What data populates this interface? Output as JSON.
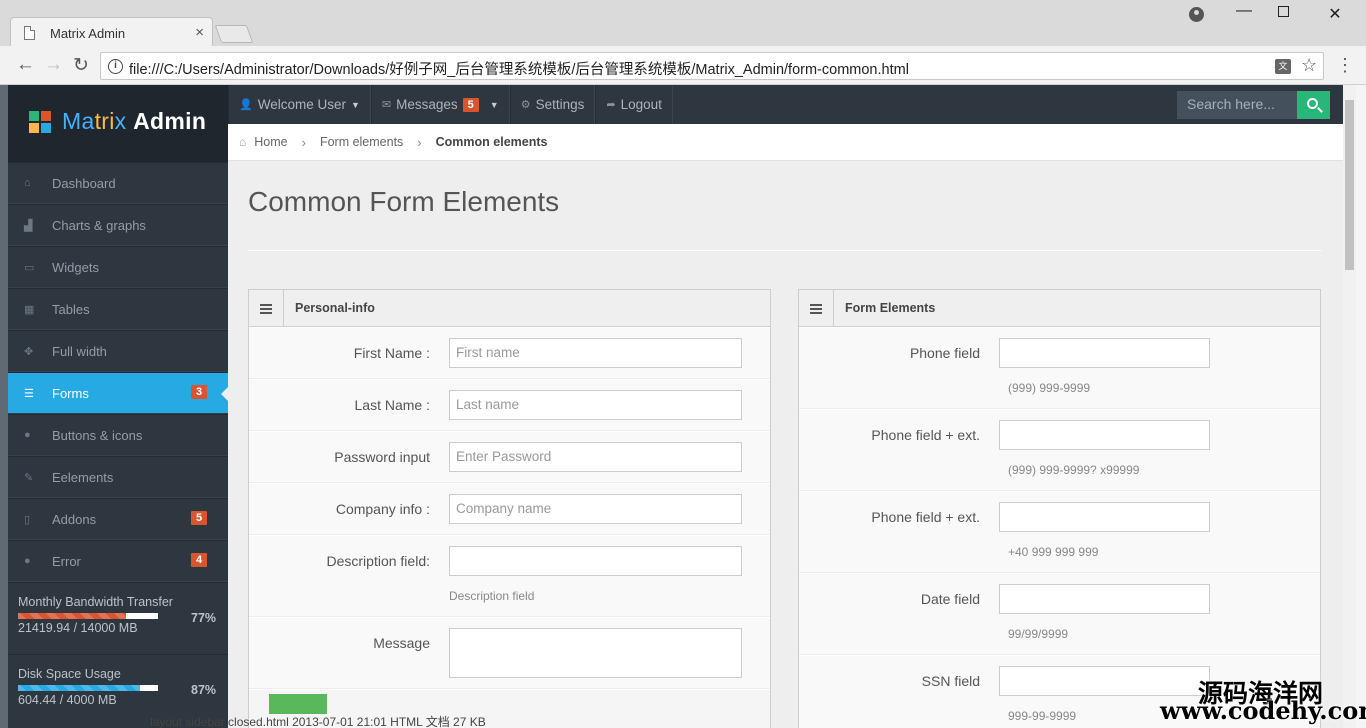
{
  "browser": {
    "tab_title": "Matrix Admin",
    "tab_close": "×",
    "url": "file:///C:/Users/Administrator/Downloads/好例子网_后台管理系统模板/后台管理系统模板/Matrix_Admin/form-common.html",
    "translate_label": "文",
    "win_min": "—",
    "win_close": "✕"
  },
  "logo": {
    "part1": "Ma",
    "part2": "tri",
    "part3": "x ",
    "part4": "Admin"
  },
  "topnav": {
    "welcome": "Welcome User",
    "messages": "Messages",
    "messages_badge": "5",
    "settings": "Settings",
    "logout": "Logout"
  },
  "search": {
    "placeholder": "Search here..."
  },
  "sidebar": {
    "items": [
      {
        "label": "Dashboard"
      },
      {
        "label": "Charts & graphs"
      },
      {
        "label": "Widgets"
      },
      {
        "label": "Tables"
      },
      {
        "label": "Full width"
      },
      {
        "label": "Forms",
        "badge": "3"
      },
      {
        "label": "Buttons & icons"
      },
      {
        "label": "Eelements"
      },
      {
        "label": "Addons",
        "badge": "5"
      },
      {
        "label": "Error",
        "badge": "4"
      }
    ],
    "stats": [
      {
        "title": "Monthly Bandwidth Transfer",
        "value": "21419.94 / 14000 MB",
        "percent": "77%",
        "level": 0.77,
        "color": "#da542e"
      },
      {
        "title": "Disk Space Usage",
        "value": "604.44 / 4000 MB",
        "percent": "87%",
        "level": 0.87,
        "color": "#27a9e3"
      }
    ]
  },
  "breadcrumb": {
    "home": "Home",
    "parent": "Form elements",
    "current": "Common elements"
  },
  "page_title": "Common Form Elements",
  "personal_info": {
    "title": "Personal-info",
    "fields": [
      {
        "label": "First Name :",
        "placeholder": "First name"
      },
      {
        "label": "Last Name :",
        "placeholder": "Last name"
      },
      {
        "label": "Password input",
        "placeholder": "Enter Password"
      },
      {
        "label": "Company info :",
        "placeholder": "Company name"
      },
      {
        "label": "Description field:",
        "placeholder": "",
        "help": "Description field"
      },
      {
        "label": "Message"
      }
    ]
  },
  "form_elements": {
    "title": "Form Elements",
    "fields": [
      {
        "label": "Phone field",
        "help": "(999) 999-9999"
      },
      {
        "label": "Phone field + ext.",
        "help": "(999) 999-9999? x99999"
      },
      {
        "label": "Phone field + ext.",
        "help": "+40 999 999 999"
      },
      {
        "label": "Date field",
        "help": "99/99/9999"
      },
      {
        "label": "SSN field",
        "help": "999-99-9999"
      }
    ]
  },
  "colors": {
    "accent": "#27a9e3",
    "sidebar": "#2e363f",
    "badge": "#da542e",
    "search_btn": "#28b779"
  },
  "desktop_ghost": "layout sidebar closed.html      2013-07-01 21:01    HTML 文档      27 KB",
  "watermark": {
    "line1": "源码海洋网",
    "line2": "www.codehy.com"
  }
}
